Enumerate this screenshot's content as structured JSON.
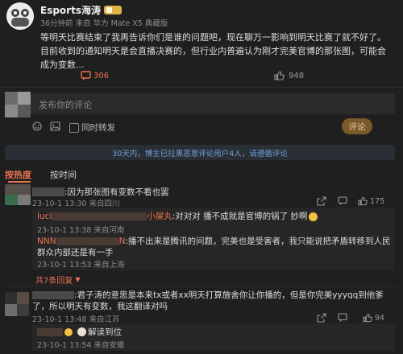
{
  "post": {
    "username": "Esports海涛",
    "badge": "",
    "meta": "36分钟前  来自 华为 Mate X5 典藏版",
    "text": "等明天比赛结束了我再告诉你们是谁的问题吧，现在聊万一影响到明天比赛了就不好了。目前收到的通知明天是会直播决赛的，但行业内普遍认为刚才完美官博的那张图，可能会成为变数...",
    "comment_count": "306",
    "like_count": "948"
  },
  "composer": {
    "placeholder": "发布你的评论",
    "forward_label": "同时转发",
    "submit_label": "评论"
  },
  "notice": {
    "text": "30天内，博主已拉黑恶意评论用户4人，请遵循评论"
  },
  "sort": {
    "hot_label": "按热度",
    "time_label": "按时间"
  },
  "comments": [
    {
      "text": ":因为那张图有变数不看也罢",
      "meta": "23-10-1 13:30 来自四川",
      "like_count": "175",
      "replies": [
        {
          "name_suffix": "小屎丸",
          "name_prefix": "luci",
          "text": ":对对对 播不成就是官博的锅了 妙啊",
          "meta": "23-10-1 13:38 来自河南"
        },
        {
          "name_prefix": "NNN",
          "name_suffix": "N",
          "text": ":播不出来是腾讯的问题，完美也是受害者，我只能说把矛盾转移到人民群众内部还是有一手",
          "meta": "23-10-1 13:53 来自上海"
        }
      ],
      "more_replies": "共7条回复"
    },
    {
      "text": ":君子涛的意思是本来tx或者xx明天打算施舍你让你播的，但是你完美yyyqq到他爹了，所以明天有变数，我这翻译对吗",
      "meta": "23-10-1 13:48 来自江苏",
      "like_count": "94",
      "replies": [
        {
          "text": "解读到位",
          "meta": "23-10-1 13:54 来自安徽"
        }
      ]
    }
  ],
  "colors": {
    "background": "#1f1f1f",
    "accent": "#eb7350",
    "link": "#eb7350",
    "notice_bg": "#2a2f36",
    "notice_text": "#6ea0d8",
    "badge": "#e0b24a"
  }
}
